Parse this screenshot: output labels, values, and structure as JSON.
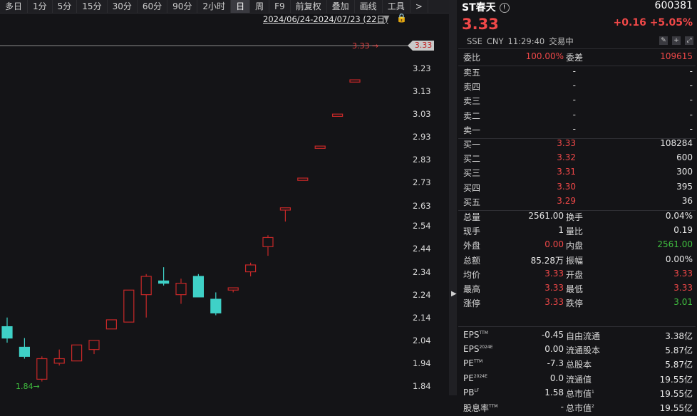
{
  "toolbar": [
    "多日",
    "1分",
    "5分",
    "15分",
    "30分",
    "60分",
    "90分",
    "2小时",
    "日",
    "周",
    "F9",
    "前复权",
    "叠加",
    "画线",
    "工具",
    ">"
  ],
  "toolbar_active": "日",
  "date_range": "2024/06/24-2024/07/23 (22日)",
  "chart_data": {
    "type": "candlestick",
    "yticks": [
      "3.23",
      "3.13",
      "3.03",
      "2.93",
      "2.83",
      "2.73",
      "2.63",
      "2.54",
      "2.44",
      "2.34",
      "2.24",
      "2.14",
      "2.04",
      "1.94",
      "1.84"
    ],
    "current_price_label": "3.33",
    "last_price_line_label": "3.33",
    "low_marker_label": "1.84",
    "candles": [
      {
        "o": 2.1,
        "h": 2.14,
        "l": 2.03,
        "c": 2.05,
        "dir": "down"
      },
      {
        "o": 2.01,
        "h": 2.05,
        "l": 1.96,
        "c": 1.97,
        "dir": "down"
      },
      {
        "o": 1.87,
        "h": 1.97,
        "l": 1.86,
        "c": 1.96,
        "dir": "up"
      },
      {
        "o": 1.94,
        "h": 2.0,
        "l": 1.93,
        "c": 1.96,
        "dir": "up"
      },
      {
        "o": 1.95,
        "h": 2.02,
        "l": 1.95,
        "c": 2.02,
        "dir": "up"
      },
      {
        "o": 2.0,
        "h": 2.04,
        "l": 1.98,
        "c": 2.04,
        "dir": "up"
      },
      {
        "o": 2.09,
        "h": 2.13,
        "l": 2.09,
        "c": 2.13,
        "dir": "up"
      },
      {
        "o": 2.12,
        "h": 2.26,
        "l": 2.12,
        "c": 2.26,
        "dir": "up"
      },
      {
        "o": 2.24,
        "h": 2.33,
        "l": 2.14,
        "c": 2.32,
        "dir": "up"
      },
      {
        "o": 2.3,
        "h": 2.36,
        "l": 2.28,
        "c": 2.29,
        "dir": "down"
      },
      {
        "o": 2.24,
        "h": 2.31,
        "l": 2.2,
        "c": 2.29,
        "dir": "up"
      },
      {
        "o": 2.32,
        "h": 2.33,
        "l": 2.23,
        "c": 2.23,
        "dir": "down"
      },
      {
        "o": 2.22,
        "h": 2.25,
        "l": 2.15,
        "c": 2.16,
        "dir": "down"
      },
      {
        "o": 2.26,
        "h": 2.27,
        "l": 2.25,
        "c": 2.27,
        "dir": "up"
      },
      {
        "o": 2.34,
        "h": 2.38,
        "l": 2.32,
        "c": 2.37,
        "dir": "up"
      },
      {
        "o": 2.45,
        "h": 2.5,
        "l": 2.41,
        "c": 2.49,
        "dir": "up"
      },
      {
        "o": 2.61,
        "h": 2.62,
        "l": 2.56,
        "c": 2.62,
        "dir": "up"
      },
      {
        "o": 2.74,
        "h": 2.75,
        "l": 2.74,
        "c": 2.75,
        "dir": "up"
      },
      {
        "o": 2.88,
        "h": 2.89,
        "l": 2.88,
        "c": 2.89,
        "dir": "up"
      },
      {
        "o": 3.02,
        "h": 3.03,
        "l": 3.02,
        "c": 3.03,
        "dir": "up"
      },
      {
        "o": 3.17,
        "h": 3.18,
        "l": 3.17,
        "c": 3.18,
        "dir": "up"
      }
    ]
  },
  "quote": {
    "name": "ST春天",
    "code": "600381",
    "price": "3.33",
    "change": "+0.16",
    "change_pct": "+5.05%",
    "exchange": "SSE",
    "currency": "CNY",
    "time": "11:29:40",
    "status": "交易中"
  },
  "order_ratio": {
    "label1": "委比",
    "val1": "100.00%",
    "label2": "委差",
    "val2": "109615"
  },
  "asks": [
    {
      "label": "卖五",
      "price": "-",
      "vol": "-"
    },
    {
      "label": "卖四",
      "price": "-",
      "vol": "-"
    },
    {
      "label": "卖三",
      "price": "-",
      "vol": "-"
    },
    {
      "label": "卖二",
      "price": "-",
      "vol": "-"
    },
    {
      "label": "卖一",
      "price": "-",
      "vol": "-"
    }
  ],
  "bids": [
    {
      "label": "买一",
      "price": "3.33",
      "vol": "108284"
    },
    {
      "label": "买二",
      "price": "3.32",
      "vol": "600"
    },
    {
      "label": "买三",
      "price": "3.31",
      "vol": "300"
    },
    {
      "label": "买四",
      "price": "3.30",
      "vol": "395"
    },
    {
      "label": "买五",
      "price": "3.29",
      "vol": "36"
    }
  ],
  "stats": [
    {
      "l1": "总量",
      "v1": "2561.00",
      "l2": "换手",
      "v2": "0.04%",
      "c1": "white",
      "c2": "white"
    },
    {
      "l1": "现手",
      "v1": "1",
      "l2": "量比",
      "v2": "0.19",
      "c1": "white",
      "c2": "white"
    },
    {
      "l1": "外盘",
      "v1": "0.00",
      "l2": "内盘",
      "v2": "2561.00",
      "c1": "red",
      "c2": "green"
    },
    {
      "l1": "总额",
      "v1": "85.28万",
      "l2": "振幅",
      "v2": "0.00%",
      "c1": "white",
      "c2": "white"
    },
    {
      "l1": "均价",
      "v1": "3.33",
      "l2": "开盘",
      "v2": "3.33",
      "c1": "red",
      "c2": "red"
    },
    {
      "l1": "最高",
      "v1": "3.33",
      "l2": "最低",
      "v2": "3.33",
      "c1": "red",
      "c2": "red"
    },
    {
      "l1": "涨停",
      "v1": "3.33",
      "l2": "跌停",
      "v2": "3.01",
      "c1": "red",
      "c2": "green"
    }
  ],
  "fundamentals": [
    {
      "l1": "EPS",
      "s1": "TTM",
      "v1": "-0.45",
      "l2": "自由流通",
      "s2": "",
      "v2": "3.38亿"
    },
    {
      "l1": "EPS",
      "s1": "2024E",
      "v1": "0.00",
      "l2": "流通股本",
      "s2": "",
      "v2": "5.87亿"
    },
    {
      "l1": "PE",
      "s1": "TTM",
      "v1": "-7.3",
      "l2": "总股本",
      "s2": "",
      "v2": "5.87亿"
    },
    {
      "l1": "PE",
      "s1": "2024E",
      "v1": "0.0",
      "l2": "流通值",
      "s2": "",
      "v2": "19.55亿"
    },
    {
      "l1": "PB",
      "s1": "LF",
      "v1": "1.58",
      "l2": "总市值",
      "s2": "1",
      "v2": "19.55亿"
    },
    {
      "l1": "股息率",
      "s1": "TTM",
      "v1": "-",
      "l2": "总市值",
      "s2": "2",
      "v2": "19.55亿"
    }
  ],
  "colors": {
    "up": "#c62828",
    "down": "#3fd1c7",
    "accent_red": "#f04848",
    "accent_green": "#40c040"
  }
}
